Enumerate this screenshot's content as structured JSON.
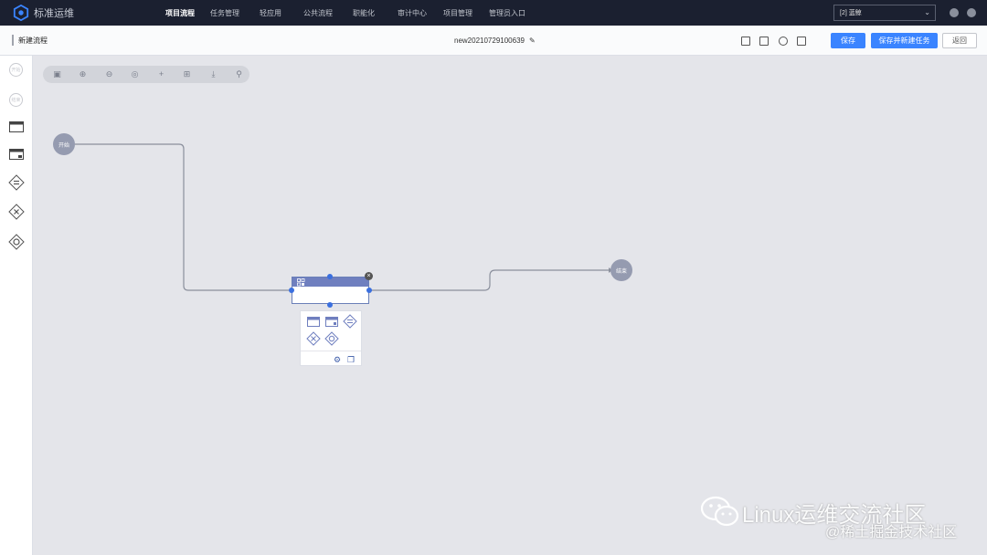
{
  "app": {
    "name": "标准运维"
  },
  "nav": {
    "items": [
      {
        "label": "项目流程",
        "active": true
      },
      {
        "label": "任务管理",
        "active": false
      },
      {
        "label": "轻应用",
        "active": false
      },
      {
        "label": "公共流程",
        "active": false
      },
      {
        "label": "职能化",
        "active": false
      },
      {
        "label": "审计中心",
        "active": false
      },
      {
        "label": "项目管理",
        "active": false
      },
      {
        "label": "管理员入口",
        "active": false
      }
    ],
    "business_select": "[2] 蓝鲸"
  },
  "header": {
    "title": "新建流程",
    "flow_name": "new20210729100639",
    "save_label": "保存",
    "save_new_task_label": "保存并新建任务",
    "back_label": "返回"
  },
  "palette": {
    "start_label": "开始",
    "end_label": "结束"
  },
  "canvas": {
    "start_node_label": "开始",
    "end_node_label": "结束"
  },
  "watermark": {
    "line1": "Linux运维交流社区",
    "line2": "@稀土掘金技术社区"
  },
  "colors": {
    "nav_bg": "#1b2030",
    "primary": "#3a84ff",
    "node": "#959bb0",
    "task_header": "#6f7fbf"
  }
}
